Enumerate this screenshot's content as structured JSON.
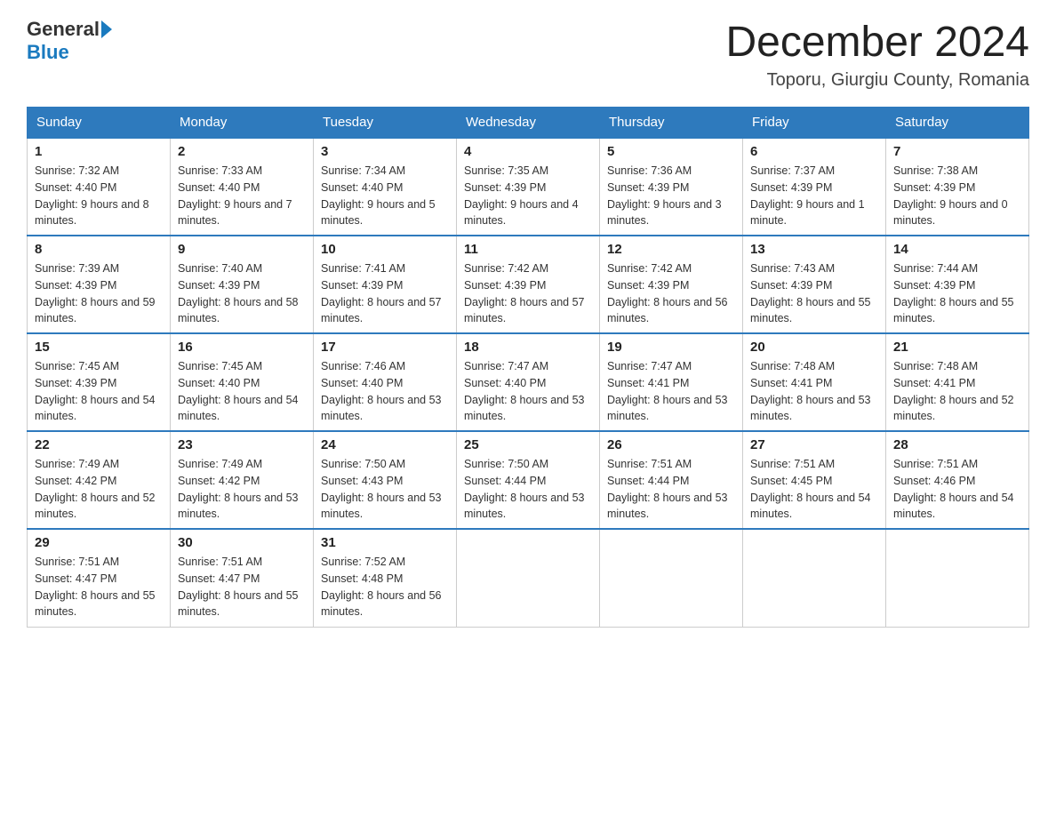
{
  "header": {
    "logo_general": "General",
    "logo_blue": "Blue",
    "month": "December 2024",
    "location": "Toporu, Giurgiu County, Romania"
  },
  "days_of_week": [
    "Sunday",
    "Monday",
    "Tuesday",
    "Wednesday",
    "Thursday",
    "Friday",
    "Saturday"
  ],
  "weeks": [
    [
      {
        "day": "1",
        "sunrise": "7:32 AM",
        "sunset": "4:40 PM",
        "daylight": "9 hours and 8 minutes."
      },
      {
        "day": "2",
        "sunrise": "7:33 AM",
        "sunset": "4:40 PM",
        "daylight": "9 hours and 7 minutes."
      },
      {
        "day": "3",
        "sunrise": "7:34 AM",
        "sunset": "4:40 PM",
        "daylight": "9 hours and 5 minutes."
      },
      {
        "day": "4",
        "sunrise": "7:35 AM",
        "sunset": "4:39 PM",
        "daylight": "9 hours and 4 minutes."
      },
      {
        "day": "5",
        "sunrise": "7:36 AM",
        "sunset": "4:39 PM",
        "daylight": "9 hours and 3 minutes."
      },
      {
        "day": "6",
        "sunrise": "7:37 AM",
        "sunset": "4:39 PM",
        "daylight": "9 hours and 1 minute."
      },
      {
        "day": "7",
        "sunrise": "7:38 AM",
        "sunset": "4:39 PM",
        "daylight": "9 hours and 0 minutes."
      }
    ],
    [
      {
        "day": "8",
        "sunrise": "7:39 AM",
        "sunset": "4:39 PM",
        "daylight": "8 hours and 59 minutes."
      },
      {
        "day": "9",
        "sunrise": "7:40 AM",
        "sunset": "4:39 PM",
        "daylight": "8 hours and 58 minutes."
      },
      {
        "day": "10",
        "sunrise": "7:41 AM",
        "sunset": "4:39 PM",
        "daylight": "8 hours and 57 minutes."
      },
      {
        "day": "11",
        "sunrise": "7:42 AM",
        "sunset": "4:39 PM",
        "daylight": "8 hours and 57 minutes."
      },
      {
        "day": "12",
        "sunrise": "7:42 AM",
        "sunset": "4:39 PM",
        "daylight": "8 hours and 56 minutes."
      },
      {
        "day": "13",
        "sunrise": "7:43 AM",
        "sunset": "4:39 PM",
        "daylight": "8 hours and 55 minutes."
      },
      {
        "day": "14",
        "sunrise": "7:44 AM",
        "sunset": "4:39 PM",
        "daylight": "8 hours and 55 minutes."
      }
    ],
    [
      {
        "day": "15",
        "sunrise": "7:45 AM",
        "sunset": "4:39 PM",
        "daylight": "8 hours and 54 minutes."
      },
      {
        "day": "16",
        "sunrise": "7:45 AM",
        "sunset": "4:40 PM",
        "daylight": "8 hours and 54 minutes."
      },
      {
        "day": "17",
        "sunrise": "7:46 AM",
        "sunset": "4:40 PM",
        "daylight": "8 hours and 53 minutes."
      },
      {
        "day": "18",
        "sunrise": "7:47 AM",
        "sunset": "4:40 PM",
        "daylight": "8 hours and 53 minutes."
      },
      {
        "day": "19",
        "sunrise": "7:47 AM",
        "sunset": "4:41 PM",
        "daylight": "8 hours and 53 minutes."
      },
      {
        "day": "20",
        "sunrise": "7:48 AM",
        "sunset": "4:41 PM",
        "daylight": "8 hours and 53 minutes."
      },
      {
        "day": "21",
        "sunrise": "7:48 AM",
        "sunset": "4:41 PM",
        "daylight": "8 hours and 52 minutes."
      }
    ],
    [
      {
        "day": "22",
        "sunrise": "7:49 AM",
        "sunset": "4:42 PM",
        "daylight": "8 hours and 52 minutes."
      },
      {
        "day": "23",
        "sunrise": "7:49 AM",
        "sunset": "4:42 PM",
        "daylight": "8 hours and 53 minutes."
      },
      {
        "day": "24",
        "sunrise": "7:50 AM",
        "sunset": "4:43 PM",
        "daylight": "8 hours and 53 minutes."
      },
      {
        "day": "25",
        "sunrise": "7:50 AM",
        "sunset": "4:44 PM",
        "daylight": "8 hours and 53 minutes."
      },
      {
        "day": "26",
        "sunrise": "7:51 AM",
        "sunset": "4:44 PM",
        "daylight": "8 hours and 53 minutes."
      },
      {
        "day": "27",
        "sunrise": "7:51 AM",
        "sunset": "4:45 PM",
        "daylight": "8 hours and 54 minutes."
      },
      {
        "day": "28",
        "sunrise": "7:51 AM",
        "sunset": "4:46 PM",
        "daylight": "8 hours and 54 minutes."
      }
    ],
    [
      {
        "day": "29",
        "sunrise": "7:51 AM",
        "sunset": "4:47 PM",
        "daylight": "8 hours and 55 minutes."
      },
      {
        "day": "30",
        "sunrise": "7:51 AM",
        "sunset": "4:47 PM",
        "daylight": "8 hours and 55 minutes."
      },
      {
        "day": "31",
        "sunrise": "7:52 AM",
        "sunset": "4:48 PM",
        "daylight": "8 hours and 56 minutes."
      },
      null,
      null,
      null,
      null
    ]
  ],
  "labels": {
    "sunrise": "Sunrise:",
    "sunset": "Sunset:",
    "daylight": "Daylight:"
  }
}
